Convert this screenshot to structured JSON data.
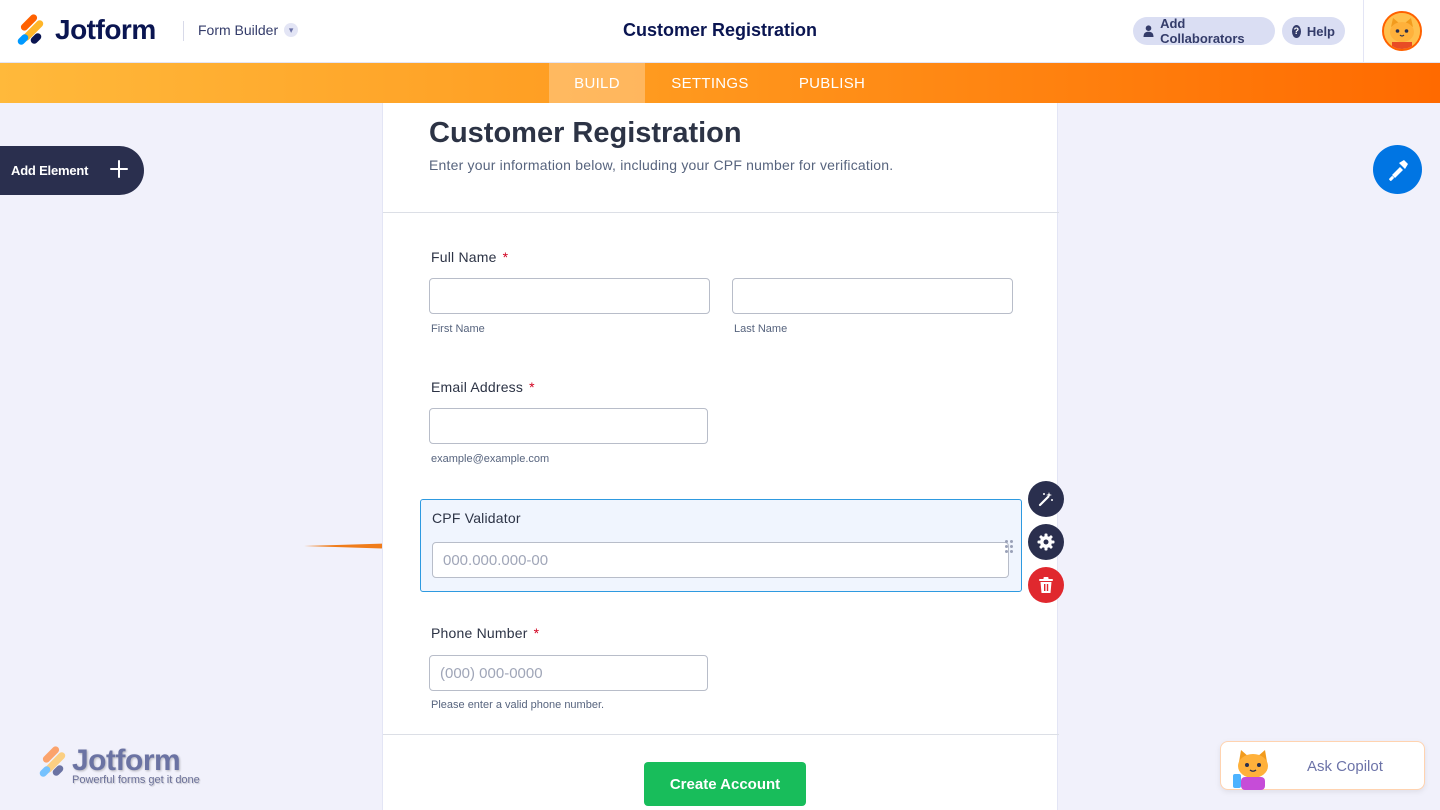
{
  "header": {
    "logo_text": "Jotform",
    "builder_label": "Form Builder",
    "title": "Customer Registration",
    "collaborators_label": "Add Collaborators",
    "help_label": "Help"
  },
  "nav": {
    "tabs": [
      {
        "label": "BUILD",
        "active": true
      },
      {
        "label": "SETTINGS",
        "active": false
      },
      {
        "label": "PUBLISH",
        "active": false
      }
    ]
  },
  "sidebar": {
    "add_element_label": "Add Element"
  },
  "form": {
    "heading": "Customer Registration",
    "subheading": "Enter your information below, including your CPF number for verification.",
    "full_name": {
      "label": "Full Name",
      "required_mark": "*",
      "first_sublabel": "First Name",
      "last_sublabel": "Last Name",
      "first_value": "",
      "last_value": ""
    },
    "email": {
      "label": "Email Address",
      "required_mark": "*",
      "value": "",
      "sublabel": "example@example.com"
    },
    "cpf": {
      "label": "CPF Validator",
      "placeholder": "000.000.000-00",
      "value": ""
    },
    "phone": {
      "label": "Phone Number",
      "required_mark": "*",
      "placeholder": "(000) 000-0000",
      "value": "",
      "sublabel": "Please enter a valid phone number."
    },
    "submit_label": "Create Account"
  },
  "field_tools": [
    "magic-wand-icon",
    "gear-icon",
    "trash-icon"
  ],
  "footer": {
    "brand_text": "Jotform",
    "brand_tagline": "Powerful forms get it done",
    "copilot_label": "Ask Copilot"
  },
  "colors": {
    "accent_orange": "#ff6100",
    "primary_blue": "#0075e3",
    "submit_green": "#18bd5b",
    "delete_red": "#e0282e",
    "navy": "#0a1551"
  }
}
